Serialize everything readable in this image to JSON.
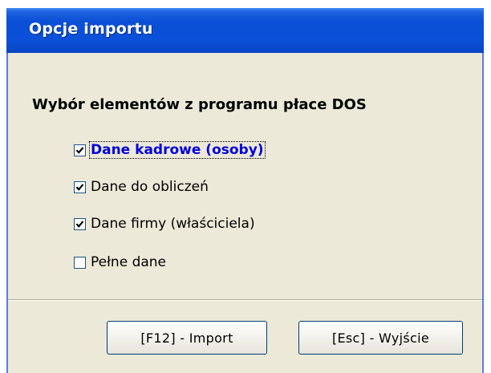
{
  "window": {
    "title": "Opcje importu"
  },
  "section": {
    "heading": "Wybór elementów z programu płace DOS"
  },
  "options": [
    {
      "label": "Dane kadrowe (osoby)",
      "checked": true,
      "focused": true
    },
    {
      "label": "Dane do obliczeń",
      "checked": true,
      "focused": false
    },
    {
      "label": "Dane firmy (właściciela)",
      "checked": true,
      "focused": false
    },
    {
      "label": "Pełne dane",
      "checked": false,
      "focused": false
    }
  ],
  "buttons": {
    "import_label": "[F12] - Import",
    "exit_label": "[Esc] - Wyjście"
  },
  "colors": {
    "titlebar": "#0a50d8",
    "dialog_bg": "#ece9d8",
    "focused_label": "#0000e0"
  }
}
